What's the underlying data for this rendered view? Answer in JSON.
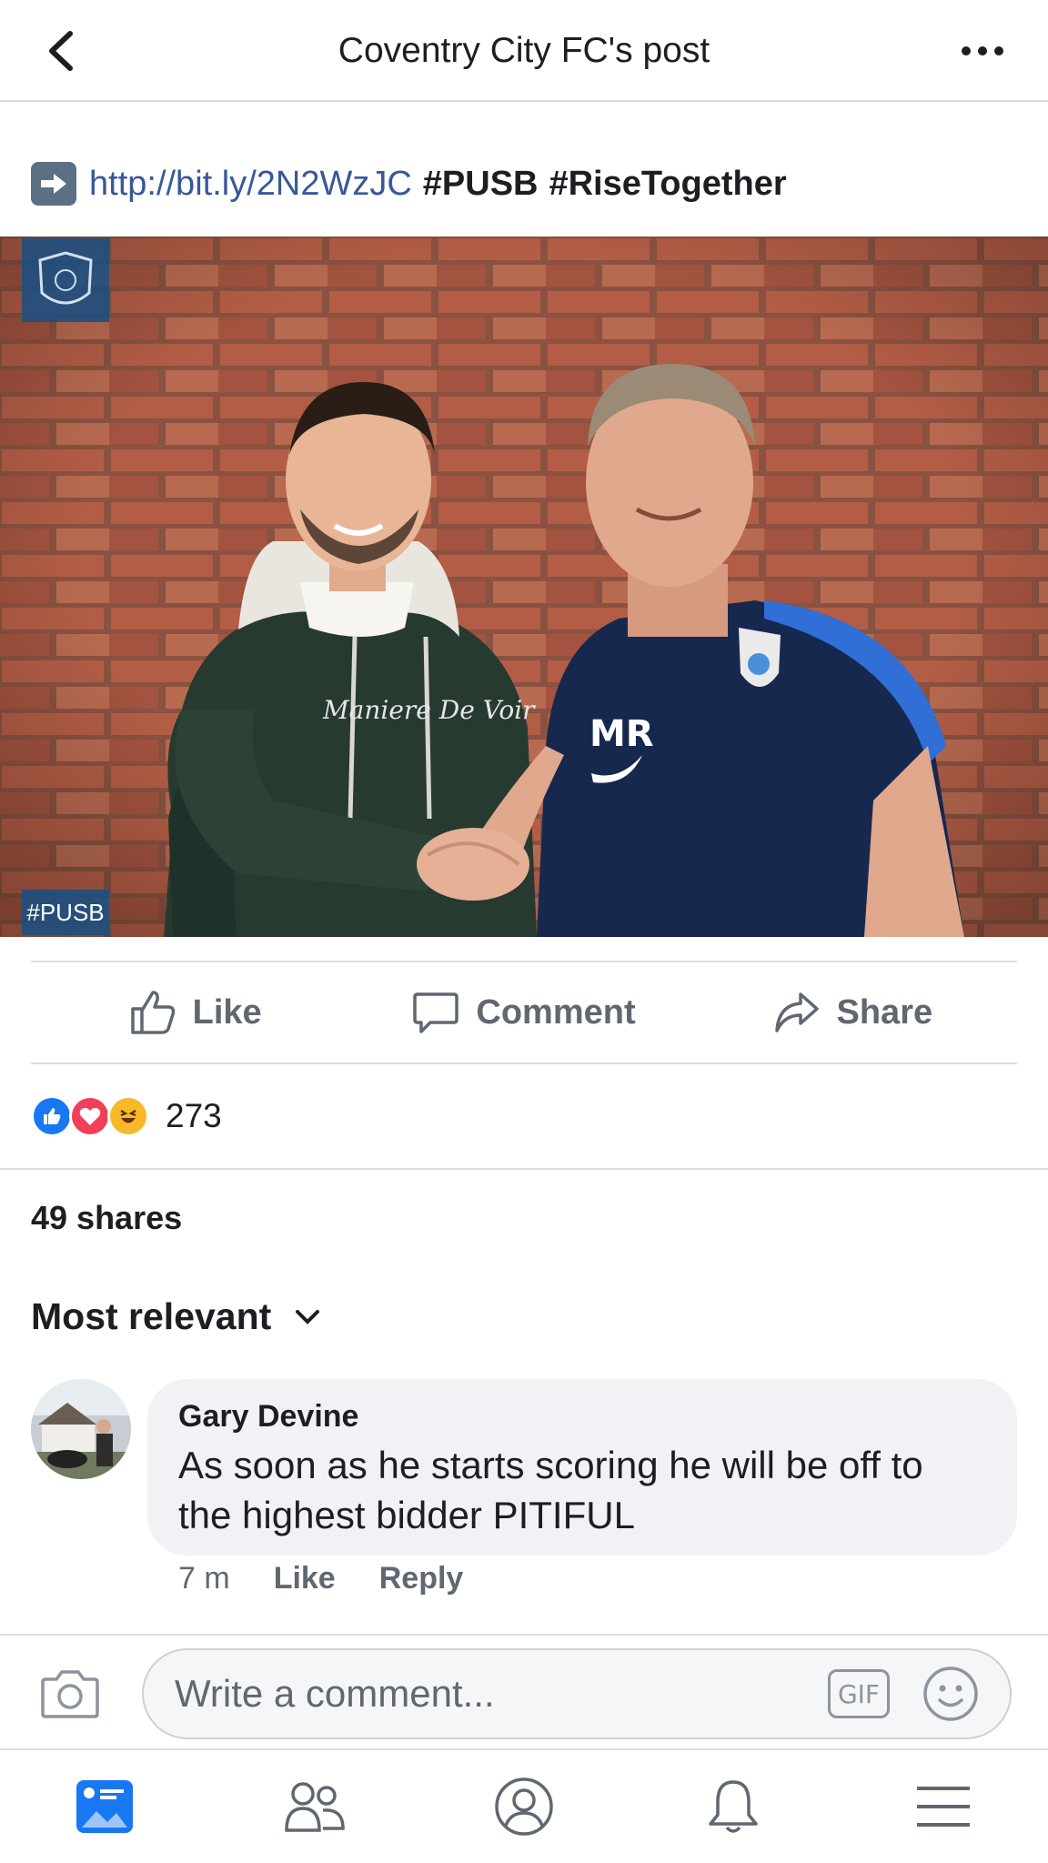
{
  "header": {
    "title": "Coventry City FC's post"
  },
  "post": {
    "link": "http://bit.ly/2N2WzJC",
    "hashtags": [
      "#PUSB",
      "#RiseTogether"
    ],
    "photo": {
      "badge_text": "#PUSB",
      "shirt_initials": "MR",
      "hoodie_text": "Maniere De Voir"
    }
  },
  "actions": {
    "like": "Like",
    "comment": "Comment",
    "share": "Share"
  },
  "reactions": {
    "count": "273",
    "types": [
      "like",
      "love",
      "haha"
    ]
  },
  "shares": "49 shares",
  "sort": {
    "label": "Most relevant"
  },
  "comment": {
    "author": "Gary Devine",
    "text": "As soon as he starts scoring he will be off to the highest bidder PITIFUL",
    "time": "7 m",
    "like": "Like",
    "reply": "Reply"
  },
  "composer": {
    "placeholder": "Write a comment...",
    "gif": "GIF"
  },
  "nav": [
    "news-feed",
    "friends",
    "profile",
    "notifications",
    "menu"
  ],
  "colors": {
    "link": "#385898",
    "like_blue": "#1877f2",
    "love_red": "#f33e58",
    "haha_yellow": "#f7b928",
    "muted": "#606770"
  }
}
